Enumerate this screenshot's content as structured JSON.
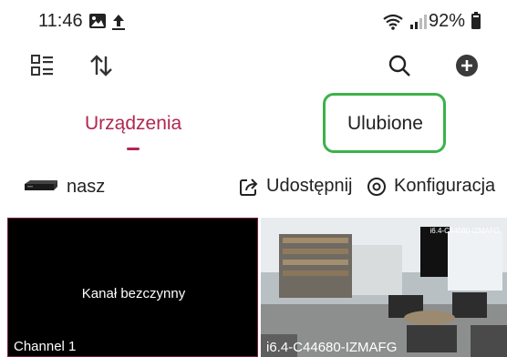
{
  "status": {
    "time": "11:46",
    "battery_percent": "92%",
    "icons": [
      "image-icon",
      "upload-icon",
      "wifi-icon",
      "signal-icon",
      "battery-icon"
    ]
  },
  "toolbar": {
    "icons": [
      "list-view-icon",
      "sort-icon",
      "search-icon",
      "add-icon"
    ]
  },
  "tabs": [
    {
      "label": "Urządzenia",
      "active": true
    },
    {
      "label": "Ulubione",
      "active": false
    }
  ],
  "device": {
    "name": "nasz",
    "share_label": "Udostępnij",
    "config_label": "Konfiguracja"
  },
  "channels": [
    {
      "label": "Channel 1",
      "status": "Kanał bezczynny"
    },
    {
      "label": "i6.4-C44680-IZMAFG",
      "overlay": "i6.4-C44680-IZMAFG"
    }
  ],
  "colors": {
    "accent": "#b0274f",
    "highlight": "#3cb24a"
  }
}
